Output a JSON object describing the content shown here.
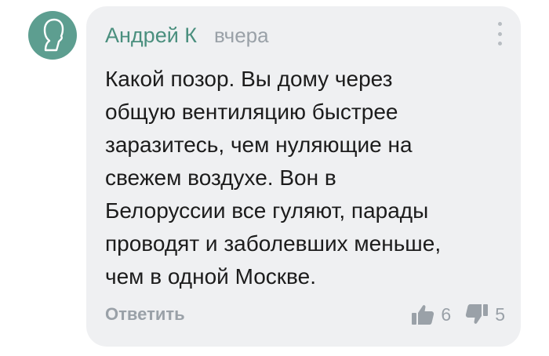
{
  "comment": {
    "author": "Андрей К",
    "time": "вчера",
    "text_lines": [
      "Какой позор. Вы дому через",
      "общую вентиляцию быстрее",
      "заразитесь, чем нуляющие на",
      "свежем воздухе.  Вон в",
      "Белоруссии все гуляют, парады",
      "проводят и заболевших меньше,",
      "чем в одной Москве."
    ],
    "reply_label": "Ответить",
    "likes": "6",
    "dislikes": "5"
  },
  "icons": {
    "avatar": "user-silhouette-icon",
    "menu": "more-vertical-icon",
    "like": "thumbs-up-icon",
    "dislike": "thumbs-down-icon"
  },
  "colors": {
    "avatar_bg": "#5d9e90",
    "author": "#4a8f7e",
    "bubble_bg": "#eff0f2",
    "muted": "#9aa1a8"
  }
}
